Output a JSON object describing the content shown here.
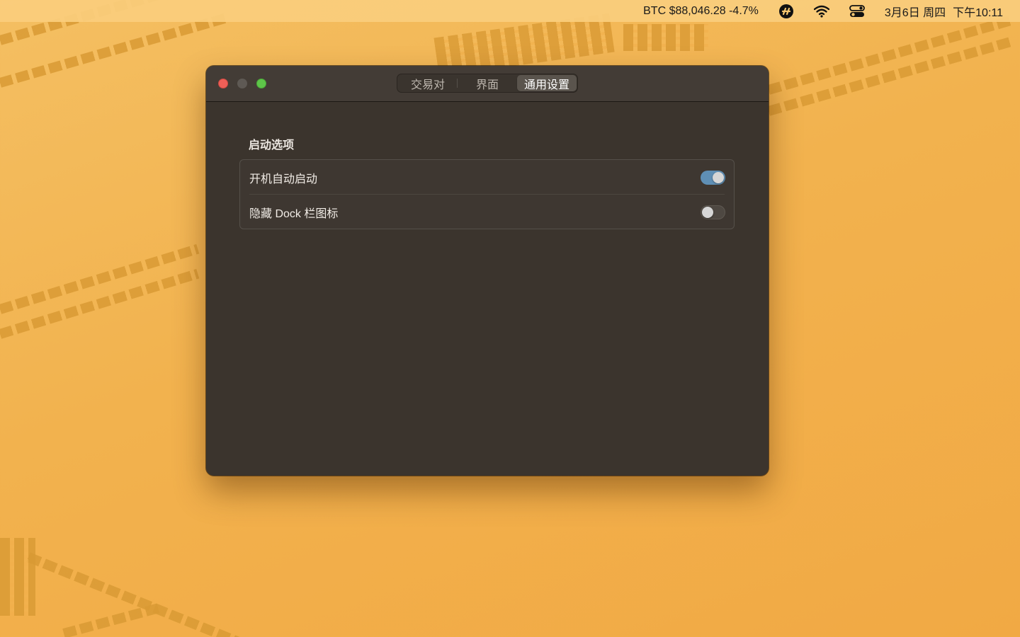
{
  "menubar": {
    "ticker": "BTC $88,046.28 -4.7%",
    "date": "3月6日 周四",
    "time": "下午10:11",
    "icons": [
      "crypto-app-icon",
      "wifi-icon",
      "control-center-icon"
    ]
  },
  "window": {
    "tabs": [
      {
        "label": "交易对",
        "active": false
      },
      {
        "label": "界面",
        "active": false
      },
      {
        "label": "通用设置",
        "active": true
      }
    ],
    "section_title": "启动选项",
    "options": [
      {
        "label": "开机自动启动",
        "enabled": true
      },
      {
        "label": "隐藏 Dock 栏图标",
        "enabled": false
      }
    ]
  },
  "colors": {
    "wallpaper": "#f2b24e",
    "window_bg": "#3b342d",
    "toggle_on": "#5f8fb5",
    "close": "#ee5f57",
    "maximize": "#5ec549"
  }
}
